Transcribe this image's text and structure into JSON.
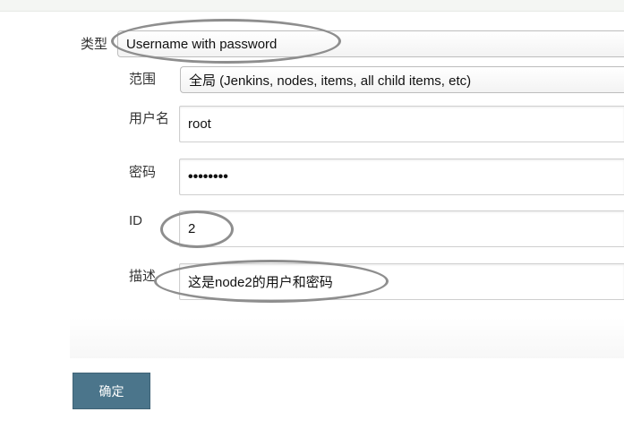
{
  "form": {
    "type": {
      "label": "类型",
      "value": "Username with password"
    },
    "scope": {
      "label": "范围",
      "value": "全局 (Jenkins, nodes, items, all child items, etc)"
    },
    "username": {
      "label": "用户名",
      "value": "root"
    },
    "password": {
      "label": "密码",
      "value": "••••••••"
    },
    "id": {
      "label": "ID",
      "value": "2"
    },
    "description": {
      "label": "描述",
      "value": "这是node2的用户和密码"
    }
  },
  "actions": {
    "confirm_label": "确定"
  },
  "colors": {
    "button": "#4b758b",
    "annotation": "#8e8e8e"
  }
}
